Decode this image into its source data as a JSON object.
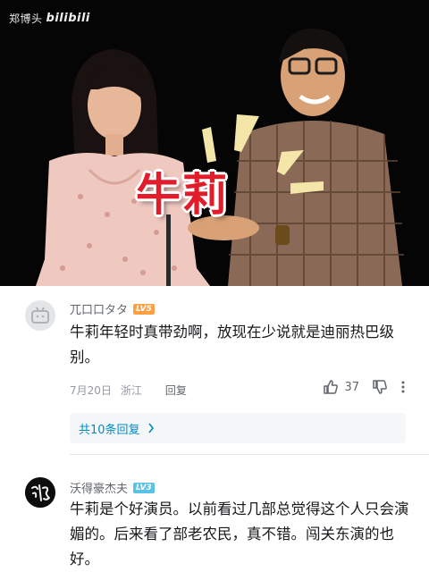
{
  "video": {
    "watermark_user": "郑博头",
    "watermark_logo": "bilibili",
    "caption": "牛莉"
  },
  "comments": [
    {
      "username": "兀口口タタ",
      "level": "LV5",
      "text": "牛莉年轻时真带劲啊，放现在少说就是迪丽热巴级别。",
      "date": "7月20日",
      "location": "浙江",
      "reply_label": "回复",
      "likes": "37",
      "more_replies": "共10条回复"
    },
    {
      "username": "沃得豪杰夫",
      "level": "LV3",
      "text": "牛莉是个好演员。以前看过几部总觉得这个人只会演媚的。后来看了部老农民，真不错。闯关东演的也好。"
    }
  ],
  "colors": {
    "caption_red": "#e21d2b",
    "link_blue": "#008ac5",
    "level5": "#ff9f3f",
    "level3": "#5bc2e7"
  },
  "icons": [
    "tv-avatar-icon",
    "thumb-up-icon",
    "thumb-down-icon",
    "more-vertical-icon",
    "chevron-right-icon"
  ]
}
